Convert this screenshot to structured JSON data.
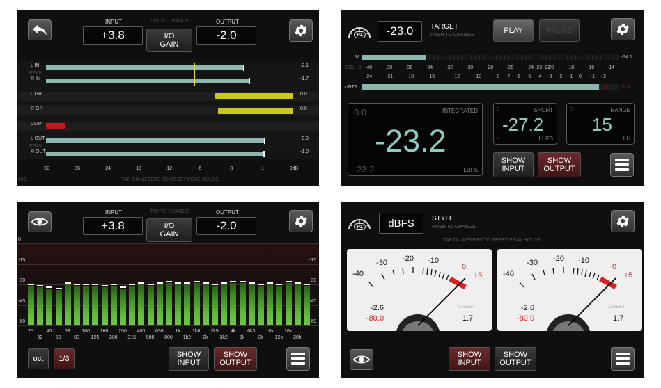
{
  "panel_io": {
    "input_label": "INPUT",
    "input_value": "+3.8",
    "hint": "TAP TO CHANGE",
    "io_gain": "I/O\nGAIN",
    "output_label": "OUTPUT",
    "output_value": "-2.0",
    "rows": [
      {
        "label": "L IN",
        "value": "-2.1"
      },
      {
        "label": "PEAK",
        "value": ""
      },
      {
        "label": "R IN",
        "value": "-1.7"
      },
      {
        "label": "L GR",
        "value": "0.0"
      },
      {
        "label": "R GR",
        "value": "0.0"
      },
      {
        "label": "CLIP",
        "value": ""
      },
      {
        "label": "L OUT",
        "value": "-0.9"
      },
      {
        "label": "PEAK",
        "value": ""
      },
      {
        "label": "R OUT",
        "value": "-1.0"
      }
    ],
    "scale": [
      "-50",
      "-36",
      "-24",
      "-18",
      "-12",
      "-6",
      "-3",
      "-1",
      "0dB"
    ],
    "footer": "TAP ON METERS TO RESET PEAK HOLDS",
    "corner": "666"
  },
  "panel_loudness": {
    "p1_badge": "P1",
    "target_value": "-23.0",
    "target_label": "TARGET",
    "target_hint": "PUSH TO CHANGE",
    "play": "PLAY",
    "pause": "PAUSE",
    "m_label": "M",
    "m_value": "-34.1",
    "ebu_label": "EBU+9",
    "scale_top": [
      "-40",
      "-38",
      "-36",
      "-34",
      "-32",
      "-30",
      "-28",
      "-26",
      "-24 -23 -22",
      "-20",
      "-18",
      "-16",
      "-14"
    ],
    "dbtp_label": "dBTP",
    "scale_bottom": [
      "-24",
      "-21",
      "-18",
      "-15",
      "-12",
      "-10",
      "-8",
      "-7",
      "-6",
      "-5",
      "-4",
      "-3",
      "-2",
      "-1",
      "0",
      "+1",
      "+2"
    ],
    "dbtp_value": "-5.6",
    "integrated_label": "INTEGRATED",
    "integrated_small": "0.0",
    "integrated_value": "-23.2",
    "integrated_bottom": "-23.2",
    "lufs": "LUFS",
    "short_label": "SHORT",
    "short_zero": "0",
    "short_zero2": "0",
    "short_value": "-27.2",
    "short_unit": "LUFS",
    "range_label": "RANGE",
    "range_zero": "0",
    "range_value": "15",
    "range_unit": "LU",
    "show_input": "SHOW\nINPUT",
    "show_output": "SHOW\nOUTPUT"
  },
  "panel_rta": {
    "input_label": "INPUT",
    "input_value": "+3.8",
    "hint": "TAP TO CHANGE",
    "io_gain": "I/O\nGAIN",
    "output_label": "OUTPUT",
    "output_value": "-2.0",
    "db_left": [
      "0",
      "-15",
      "-30",
      "-45",
      "-60"
    ],
    "db_right": [
      "-15",
      "-30",
      "-45",
      "-60"
    ],
    "freq_top": [
      "25",
      "40",
      "63",
      "100",
      "160",
      "250",
      "400",
      "630",
      "1k",
      "1k6",
      "2k5",
      "4k",
      "6k3",
      "10k",
      "16k"
    ],
    "freq_bottom": [
      "32",
      "50",
      "80",
      "125",
      "200",
      "315",
      "500",
      "800",
      "1k2",
      "2k",
      "3k2",
      "5k",
      "8k",
      "12k",
      "20k"
    ],
    "bands_db": [
      -31,
      -32,
      -33,
      -34,
      -30,
      -31,
      -31,
      -31,
      -32,
      -31,
      -33,
      -31,
      -30,
      -31,
      -30,
      -29,
      -30,
      -30,
      -29,
      -30,
      -31,
      -30,
      -29,
      -29,
      -30,
      -31,
      -30,
      -31,
      -29,
      -30,
      -31
    ],
    "oct": "oct",
    "third": "1/3",
    "show_input": "SHOW\nINPUT",
    "show_output": "SHOW\nOUTPUT"
  },
  "panel_vu": {
    "p1_badge": "P1",
    "mode_value": "dBFS",
    "style_label": "STYLE",
    "style_hint": "PUSH TO CHANGE",
    "reset_hint": "TAP ON METERS TO RESET PEAK HOLDS",
    "ticks": [
      "-40",
      "-30",
      "-20",
      "-10",
      "0",
      "+5"
    ],
    "left": {
      "value_top": "-2.6",
      "value_bottom": "-80.0",
      "crest_label": "CREST",
      "crest_value": "1.7"
    },
    "right": {
      "value_top": "-2.6",
      "value_bottom": "-80.0",
      "crest_label": "CREST",
      "crest_value": "1.7"
    },
    "show_input": "SHOW\nINPUT",
    "show_output": "SHOW\nOUTPUT"
  },
  "colors": {
    "meter_bar": "#8fb6ae",
    "gr_bar": "#c8c81e",
    "clip": "#c0181c",
    "red_button": "#5a1f1f",
    "peak_marker": "#e6e63a"
  }
}
